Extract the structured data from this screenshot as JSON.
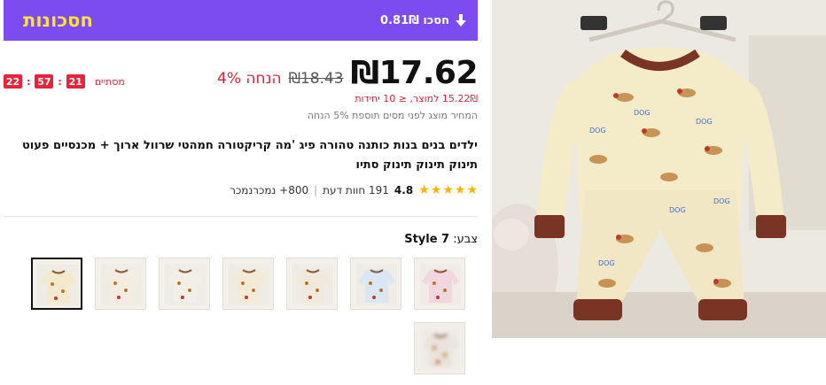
{
  "banner": {
    "title": "חסכונות",
    "savings": "0.81₪ חסכו",
    "background": "#7c4cf0",
    "title_color": "#ffe23a"
  },
  "timer": {
    "label": "מסתיים",
    "hours": "21",
    "minutes": "57",
    "seconds": "22"
  },
  "price": {
    "current": "₪17.62",
    "original": "₪18.43",
    "discount": "4% הנחה",
    "unit_price": "15.22₪ למוצר, ≤ 10 יחידות",
    "tax_note": "המחיר מוצג לפני מסים תוספת 5% הנחה"
  },
  "product": {
    "title": "ילדים בנים בנות כותנה טהורה פיג 'מה קריקטורה חמהטי שרוול ארוך + מכנסיים פעוט תינוק תינוק תינוק סתיו"
  },
  "rating": {
    "value": "4.8",
    "stars": 5,
    "reviews": "191 חוות דעת",
    "sold": "800+ נמכרנמכר"
  },
  "color": {
    "label": "צבע:",
    "value": "Style 7",
    "swatch_colors": [
      "#f3e9cf",
      "#f4ece0",
      "#f2efe6",
      "#f4ead8",
      "#f1e9dc",
      "#dbe6f3",
      "#f2d6de",
      "#e9e3db"
    ],
    "selected_index": 0
  },
  "colors": {
    "accent": "#7c4cf0",
    "sale_red": "#d6283a",
    "star": "#ffb400",
    "pajama_cream": "#f4ecc8",
    "cuff_brown": "#7a3424"
  }
}
